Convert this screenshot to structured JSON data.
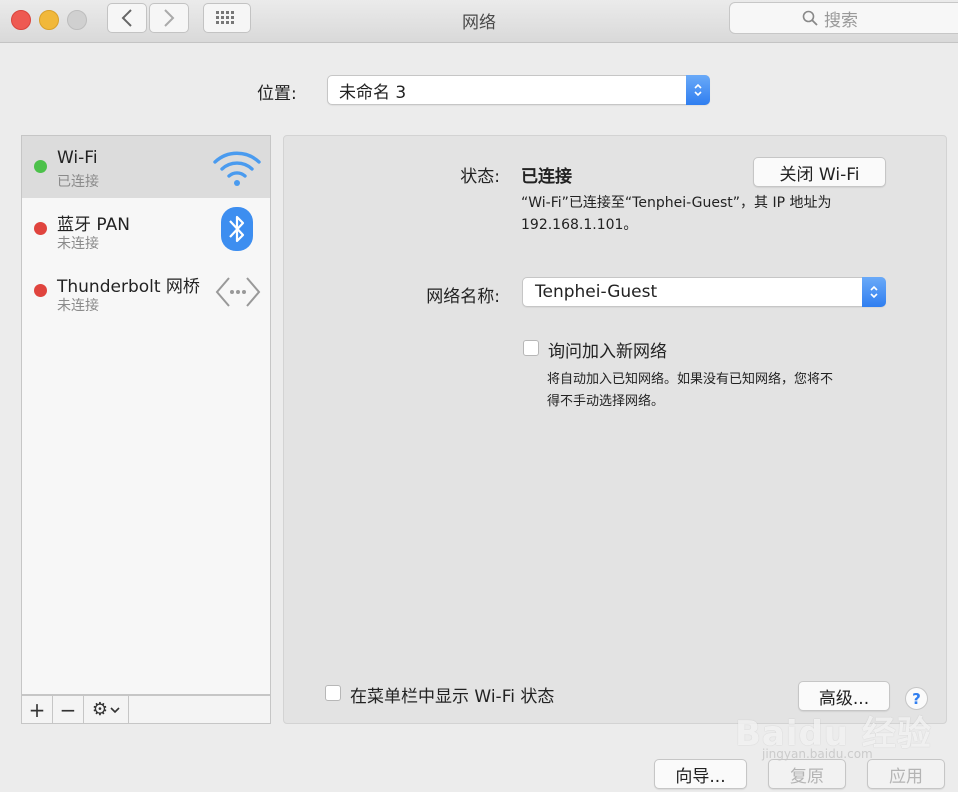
{
  "window": {
    "title": "网络",
    "search_placeholder": "搜索"
  },
  "location": {
    "label": "位置:",
    "value": "未命名 3"
  },
  "services": [
    {
      "name": "Wi-Fi",
      "status": "已连接",
      "status_color": "#4cc14a",
      "icon": "wifi-icon"
    },
    {
      "name": "蓝牙 PAN",
      "status": "未连接",
      "status_color": "#e0443e",
      "icon": "bluetooth-icon"
    },
    {
      "name": "Thunderbolt 网桥",
      "status": "未连接",
      "status_color": "#e0443e",
      "icon": "thunderbolt-bridge-icon"
    }
  ],
  "sidebar_tools": {
    "add": "+",
    "remove": "−",
    "gear": "⚙"
  },
  "detail": {
    "status_label": "状态:",
    "status_value": "已连接",
    "wifi_off_button": "关闭 Wi-Fi",
    "status_desc_line1": "“Wi-Fi”已连接至“Tenphei-Guest”，其 IP 地址为",
    "status_desc_line2": "192.168.1.101。",
    "network_name_label": "网络名称:",
    "network_name_value": "Tenphei-Guest",
    "ask_join_label": "询问加入新网络",
    "ask_join_desc_line1": "将自动加入已知网络。如果没有已知网络，您将不",
    "ask_join_desc_line2": "得不手动选择网络。",
    "show_in_menubar_label": "在菜单栏中显示 Wi-Fi 状态",
    "advanced_button": "高级...",
    "help_button": "?"
  },
  "bottom_buttons": {
    "assist": "向导...",
    "revert": "复原",
    "apply": "应用"
  },
  "watermark": {
    "text": "Baidu 经验",
    "sub": "jingyan.baidu.com"
  },
  "colors": {
    "accent": "#2f7ef0"
  }
}
